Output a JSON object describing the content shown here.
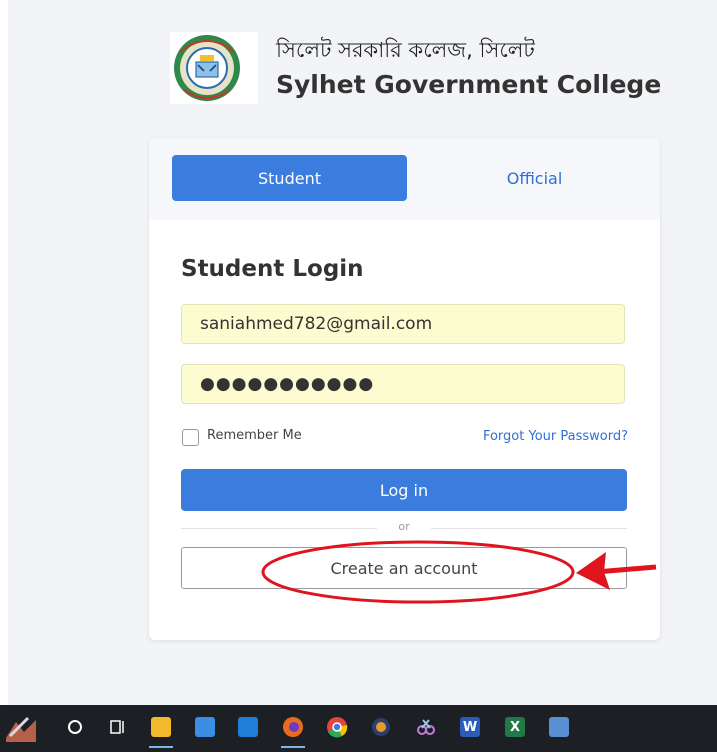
{
  "header": {
    "college_name_bn": "সিলেট সরকারি কলেজ, সিলেট",
    "college_name_en": "Sylhet Government College"
  },
  "tabs": [
    {
      "label": "Student",
      "active": true
    },
    {
      "label": "Official",
      "active": false
    }
  ],
  "form": {
    "title": "Student Login",
    "email_value": "saniahmed782@gmail.com",
    "password_masked": "●●●●●●●●●●●",
    "remember_label": "Remember Me",
    "remember_checked": false,
    "forgot_label": "Forgot Your Password?",
    "login_label": "Log in",
    "or_label": "or",
    "create_label": "Create an account"
  },
  "annotation": {
    "color": "#e0141e",
    "shapes": [
      "ellipse",
      "arrow-left"
    ]
  },
  "colors": {
    "accent": "#3a7ddf",
    "link": "#2f6fd3",
    "autofill": "#fdfbd0",
    "taskbar": "#1c1f24"
  },
  "taskbar": {
    "items": [
      "pen-app-icon",
      "search-circle-icon",
      "task-view-icon",
      "file-explorer-icon",
      "store-icon",
      "mail-icon",
      "firefox-icon",
      "chrome-icon",
      "app-icon",
      "snipping-tool-icon",
      "word-icon",
      "excel-icon",
      "app-edge-icon"
    ]
  }
}
